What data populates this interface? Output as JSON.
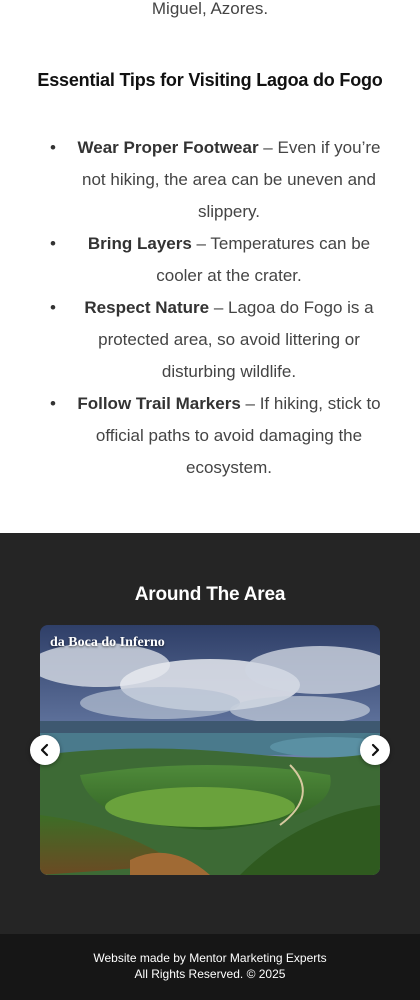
{
  "intro": {
    "tail_text": "Miguel, Azores."
  },
  "tips": {
    "heading": "Essential Tips for Visiting Lagoa do Fogo",
    "items": [
      {
        "title": "Wear Proper Footwear",
        "text": " – Even if you’re not hiking, the area can be uneven and slippery."
      },
      {
        "title": "Bring Layers",
        "text": " – Temperatures can be cooler at the crater."
      },
      {
        "title": "Respect Nature",
        "text": " – Lagoa do Fogo is a protected area, so avoid littering or disturbing wildlife."
      },
      {
        "title": "Follow Trail Markers",
        "text": " – If hiking, stick to official paths to avoid damaging the ecosystem."
      }
    ]
  },
  "area": {
    "heading": "Around The Area",
    "slide_caption": "da Boca do Inferno",
    "prev_icon": "chevron-left-icon",
    "next_icon": "chevron-right-icon"
  },
  "footer": {
    "line1": "Website made by Mentor Marketing Experts",
    "line2": "All Rights Reserved. © 2025"
  },
  "colors": {
    "dark_section": "#252525",
    "footer_bg": "#161616"
  }
}
